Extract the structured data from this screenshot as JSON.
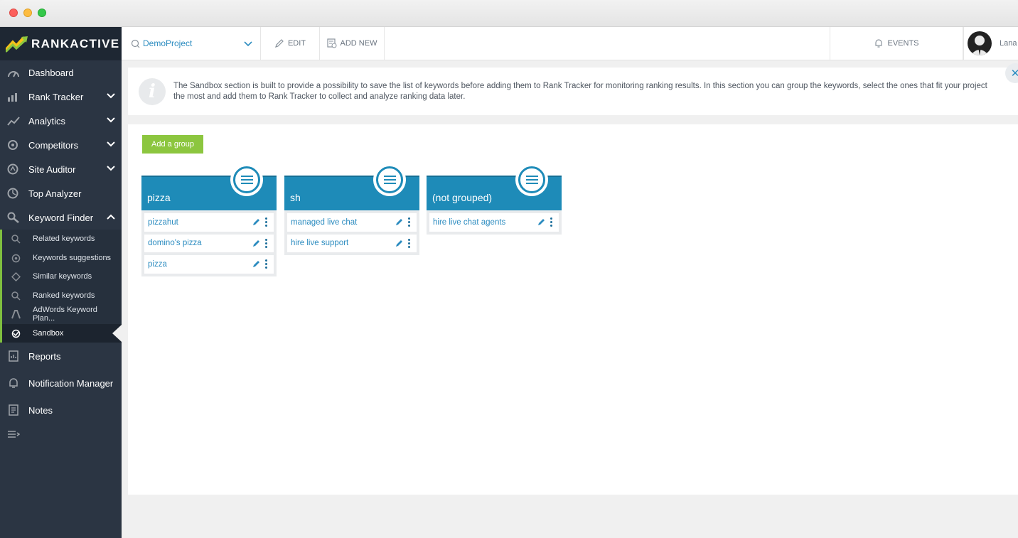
{
  "app": {
    "logo_text": "RANKACTIVE"
  },
  "sidebar": {
    "items": [
      {
        "label": "Dashboard",
        "icon": "dashboard-icon"
      },
      {
        "label": "Rank Tracker",
        "icon": "rank-tracker-icon",
        "expandable": true
      },
      {
        "label": "Analytics",
        "icon": "analytics-icon",
        "expandable": true
      },
      {
        "label": "Competitors",
        "icon": "competitors-icon",
        "expandable": true
      },
      {
        "label": "Site Auditor",
        "icon": "site-auditor-icon",
        "expandable": true
      },
      {
        "label": "Top Analyzer",
        "icon": "top-analyzer-icon"
      },
      {
        "label": "Keyword Finder",
        "icon": "keyword-finder-icon",
        "expanded": true
      }
    ],
    "keyword_finder_sub": [
      {
        "label": "Related keywords",
        "icon": "search-icon"
      },
      {
        "label": "Keywords suggestions",
        "icon": "suggestions-icon"
      },
      {
        "label": "Similar keywords",
        "icon": "similar-icon"
      },
      {
        "label": "Ranked keywords",
        "icon": "search-icon"
      },
      {
        "label": "AdWords Keyword Plan...",
        "icon": "adwords-icon"
      },
      {
        "label": "Sandbox",
        "icon": "sandbox-icon",
        "active": true
      }
    ],
    "bottom_items": [
      {
        "label": "Reports",
        "icon": "reports-icon"
      },
      {
        "label": "Notification Manager",
        "icon": "bell-icon"
      },
      {
        "label": "Notes",
        "icon": "notes-icon"
      }
    ]
  },
  "topbar": {
    "project": "DemoProject",
    "edit_label": "EDIT",
    "add_new_label": "ADD NEW",
    "events_label": "EVENTS",
    "user_name": "Lana"
  },
  "info": {
    "text": "The Sandbox section is built to provide a possibility to save the list of keywords before adding them to Rank Tracker for monitoring ranking results. In this section you can group the keywords, select the ones that fit your project the most and add them to Rank Tracker to collect and analyze ranking data later."
  },
  "main": {
    "add_group_label": "Add a group",
    "groups": [
      {
        "name": "pizza",
        "keywords": [
          "pizzahut",
          "domino's pizza",
          "pizza"
        ]
      },
      {
        "name": "sh",
        "keywords": [
          "managed live chat",
          "hire live support"
        ]
      },
      {
        "name": "(not grouped)",
        "keywords": [
          "hire live chat agents"
        ]
      }
    ]
  },
  "colors": {
    "sidebar_bg": "#2b3543",
    "accent_blue": "#1e8bb8",
    "accent_green": "#8cc63f",
    "link_blue": "#2c8cc0"
  }
}
